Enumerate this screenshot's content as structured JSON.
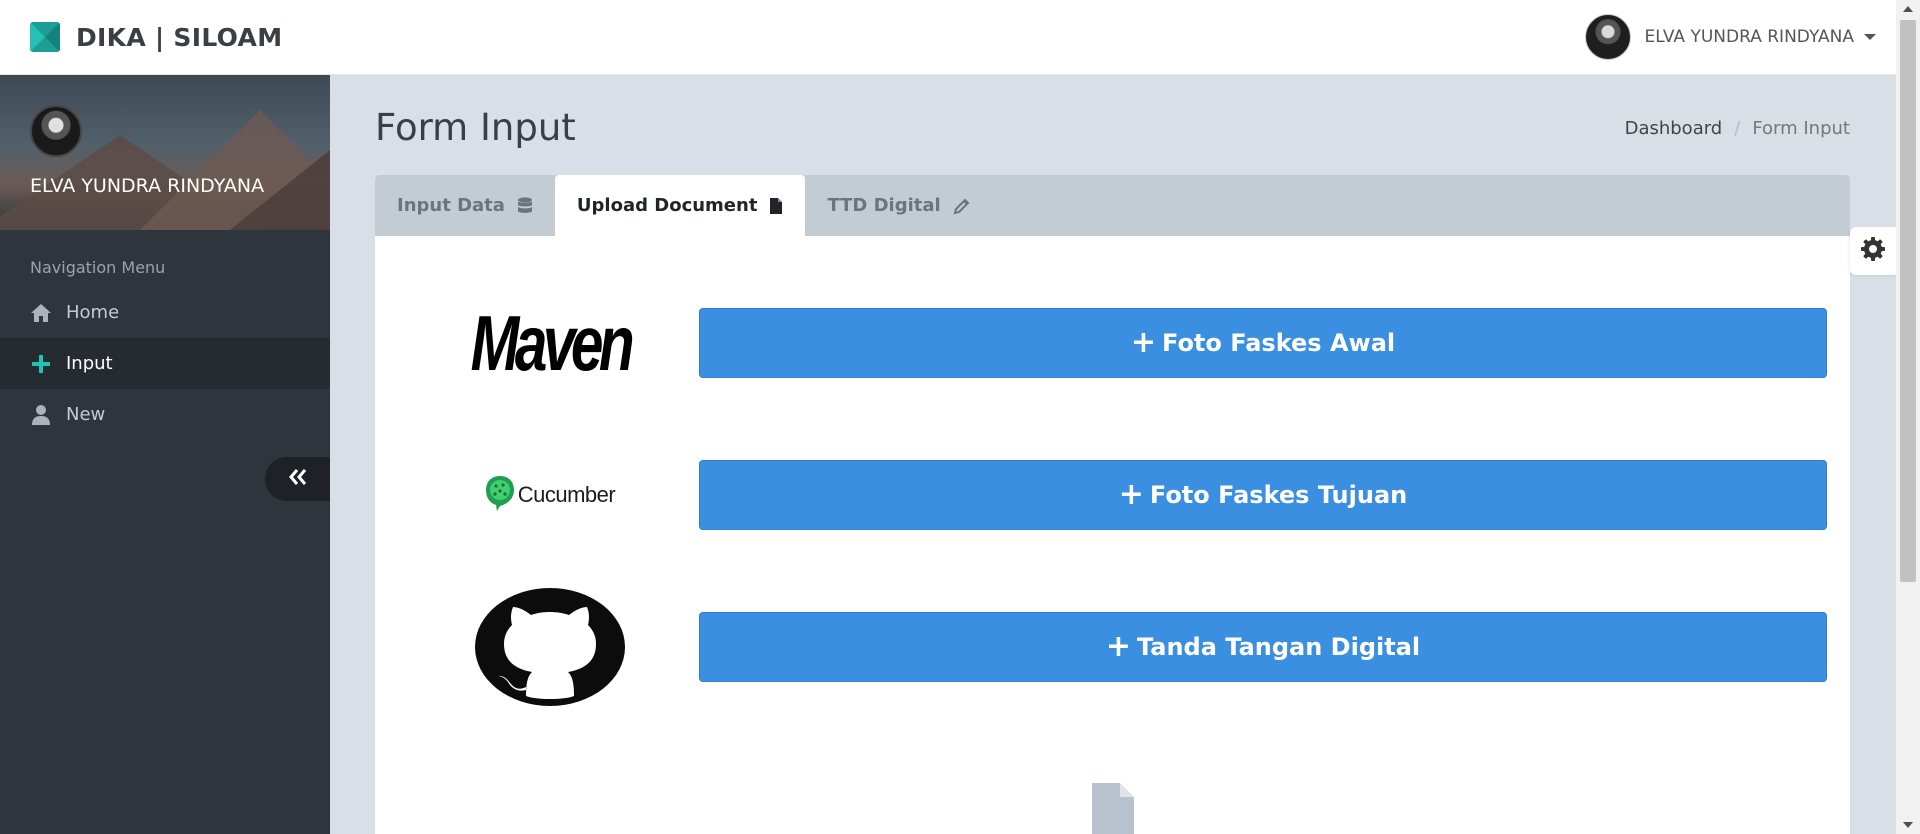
{
  "header": {
    "brand": "DIKA | SILOAM",
    "user_name": "ELVA YUNDRA RINDYANA"
  },
  "sidebar": {
    "profile_name": "ELVA YUNDRA RINDYANA",
    "nav_header": "Navigation Menu",
    "items": [
      {
        "label": "Home",
        "icon": "home-icon"
      },
      {
        "label": "Input",
        "icon": "plus-icon",
        "active": true
      },
      {
        "label": "New",
        "icon": "user-icon"
      }
    ]
  },
  "main": {
    "title": "Form Input",
    "breadcrumb": [
      "Dashboard",
      "Form Input"
    ],
    "tabs": [
      {
        "label": "Input Data",
        "icon": "database-icon"
      },
      {
        "label": "Upload Document",
        "icon": "file-icon",
        "active": true
      },
      {
        "label": "TTD Digital",
        "icon": "pencil-icon"
      }
    ],
    "uploads": [
      {
        "label": "Foto Faskes Awal",
        "logo": "maven-logo",
        "logo_text": "Maven"
      },
      {
        "label": "Foto Faskes Tujuan",
        "logo": "cucumber-logo",
        "logo_text": "Cucumber"
      },
      {
        "label": "Tanda Tangan Digital",
        "logo": "github-logo"
      }
    ]
  },
  "colors": {
    "accent": "#3b8fe0",
    "brand_teal": "#1a9e96",
    "sidebar_bg": "#2f353c",
    "content_bg": "#d8dfe7"
  }
}
